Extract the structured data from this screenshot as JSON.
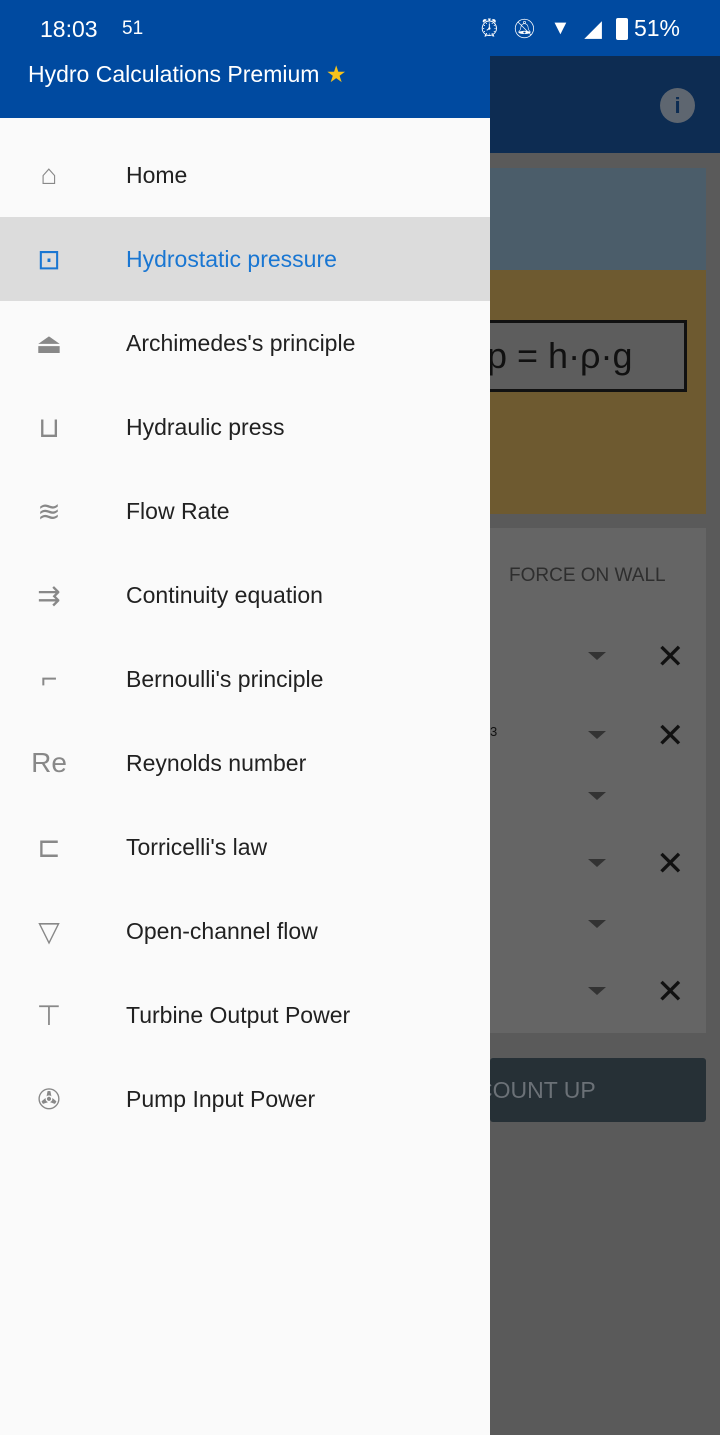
{
  "status_bar": {
    "time": "18:03",
    "notification": "51",
    "battery": "51%"
  },
  "drawer": {
    "title": "Hydro Calculations Premium",
    "title_icon": "star-icon",
    "items": [
      {
        "label": "Home",
        "icon": "home-icon",
        "selected": false
      },
      {
        "label": "Hydrostatic pressure",
        "icon": "hydrostatic-icon",
        "selected": true
      },
      {
        "label": "Archimedes's principle",
        "icon": "archimedes-icon",
        "selected": false
      },
      {
        "label": "Hydraulic press",
        "icon": "hydraulic-press-icon",
        "selected": false
      },
      {
        "label": "Flow Rate",
        "icon": "flow-rate-icon",
        "selected": false
      },
      {
        "label": "Continuity equation",
        "icon": "continuity-icon",
        "selected": false
      },
      {
        "label": "Bernoulli's principle",
        "icon": "bernoulli-icon",
        "selected": false
      },
      {
        "label": "Reynolds number",
        "icon": "reynolds-icon",
        "icon_text": "Re",
        "selected": false
      },
      {
        "label": "Torricelli's law",
        "icon": "torricelli-icon",
        "selected": false
      },
      {
        "label": "Open-channel flow",
        "icon": "open-channel-icon",
        "selected": false
      },
      {
        "label": "Turbine Output Power",
        "icon": "turbine-icon",
        "selected": false
      },
      {
        "label": "Pump Input Power",
        "icon": "pump-icon",
        "selected": false
      }
    ]
  },
  "background": {
    "formula": "p = h·ρ·g",
    "tab": "FORCE ON WALL",
    "unit_fragment": "3",
    "button": "COUNT UP"
  },
  "colors": {
    "primary": "#004aa0",
    "selected_text": "#1976d2",
    "selected_bg": "#dcdcdc"
  }
}
